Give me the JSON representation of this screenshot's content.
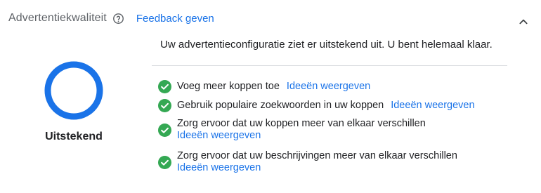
{
  "header": {
    "title": "Advertentiekwaliteit",
    "feedback_link": "Feedback geven",
    "help_icon": "help-circle-icon",
    "collapse_icon": "chevron-up-icon"
  },
  "score": {
    "label": "Uitstekend",
    "ring_color": "#1a73e8",
    "fill_fraction": 1.0
  },
  "summary": "Uw advertentieconfiguratie ziet er uitstekend uit. U bent helemaal klaar.",
  "tips": [
    {
      "text": "Voeg meer koppen toe",
      "link": "Ideeën weergeven",
      "status_icon": "check-circle-icon"
    },
    {
      "text": "Gebruik populaire zoekwoorden in uw koppen",
      "link": "Ideeën weergeven",
      "status_icon": "check-circle-icon"
    },
    {
      "text": "Zorg ervoor dat uw koppen meer van elkaar verschillen",
      "link": "Ideeën weergeven",
      "status_icon": "check-circle-icon"
    },
    {
      "text": "Zorg ervoor dat uw beschrijvingen meer van elkaar verschillen",
      "link": "Ideeën weergeven",
      "status_icon": "check-circle-icon"
    }
  ],
  "colors": {
    "link": "#1a73e8",
    "success": "#34a853",
    "muted_text": "#5f6368"
  }
}
